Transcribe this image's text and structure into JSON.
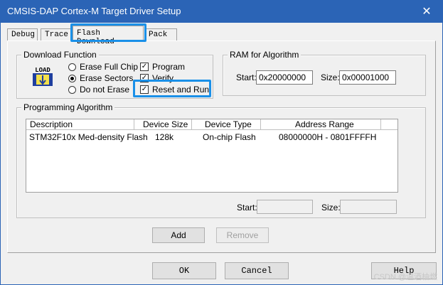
{
  "window": {
    "title": "CMSIS-DAP Cortex-M Target Driver Setup",
    "close_glyph": "✕"
  },
  "tabs": [
    {
      "label": "Debug"
    },
    {
      "label": "Trace"
    },
    {
      "label": "Flash Download"
    },
    {
      "label": "Pack"
    }
  ],
  "download_function": {
    "legend": "Download Function",
    "icon_text": "LOAD",
    "radios": [
      {
        "label": "Erase Full Chip",
        "selected": false
      },
      {
        "label": "Erase Sectors",
        "selected": true
      },
      {
        "label": "Do not Erase",
        "selected": false
      }
    ],
    "checks": [
      {
        "label": "Program",
        "checked": true
      },
      {
        "label": "Verify",
        "checked": true
      },
      {
        "label": "Reset and Run",
        "checked": true
      }
    ]
  },
  "ram": {
    "legend": "RAM for Algorithm",
    "start_label": "Start:",
    "start_value": "0x20000000",
    "size_label": "Size:",
    "size_value": "0x00001000"
  },
  "algo": {
    "legend": "Programming Algorithm",
    "columns": [
      "Description",
      "Device Size",
      "Device Type",
      "Address Range"
    ],
    "rows": [
      {
        "description": "STM32F10x Med-density Flash",
        "size": "128k",
        "type": "On-chip Flash",
        "range": "08000000H - 0801FFFFH"
      }
    ],
    "start_label": "Start:",
    "size_label": "Size:",
    "add_label": "Add",
    "remove_label": "Remove"
  },
  "footer": {
    "ok_label": "OK",
    "cancel_label": "Cancel",
    "help_label": "Help"
  },
  "watermark": "CSDN @温酒柚燃",
  "colors": {
    "titlebar": "#2b64b6",
    "highlight": "#1a90e8"
  }
}
